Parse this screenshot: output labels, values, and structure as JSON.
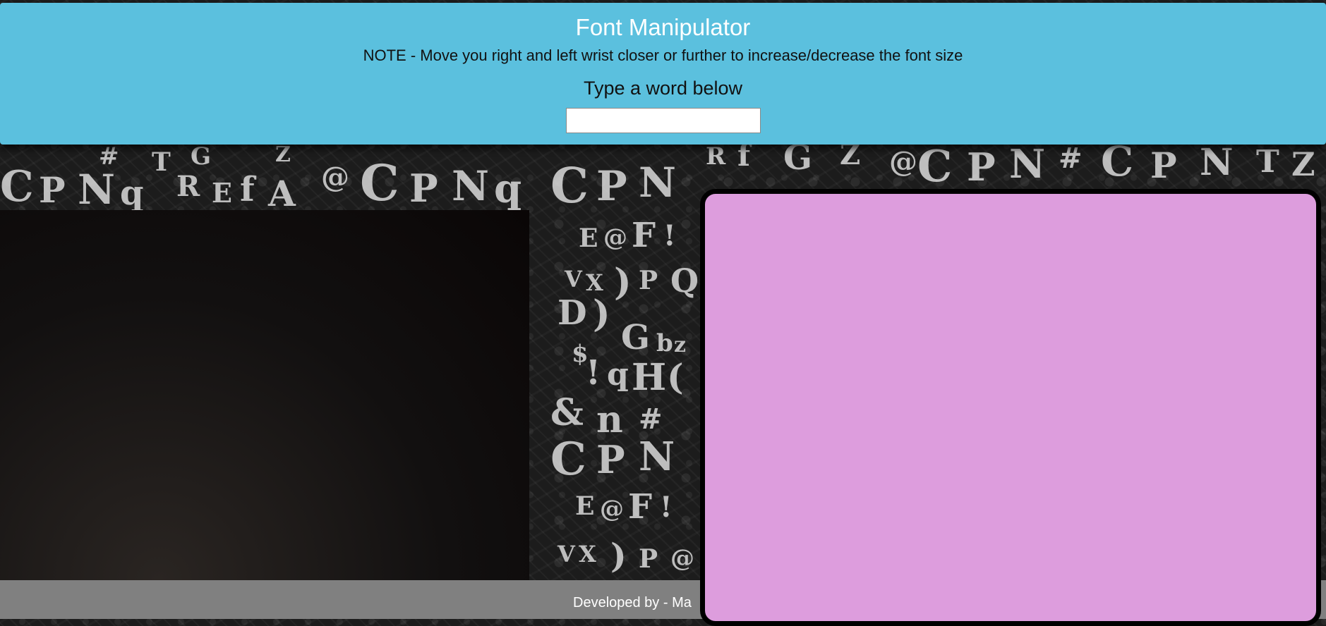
{
  "header": {
    "title": "Font Manipulator",
    "note": "NOTE - Move you right and left wrist closer or further to increase/decrease the font size",
    "prompt": "Type a word below",
    "input_value": ""
  },
  "footer": {
    "text": "Developed by - Ma"
  },
  "colors": {
    "header_bg": "#5bc0de",
    "canvas_bg": "#dd9ddd",
    "footer_bg": "#808080"
  }
}
